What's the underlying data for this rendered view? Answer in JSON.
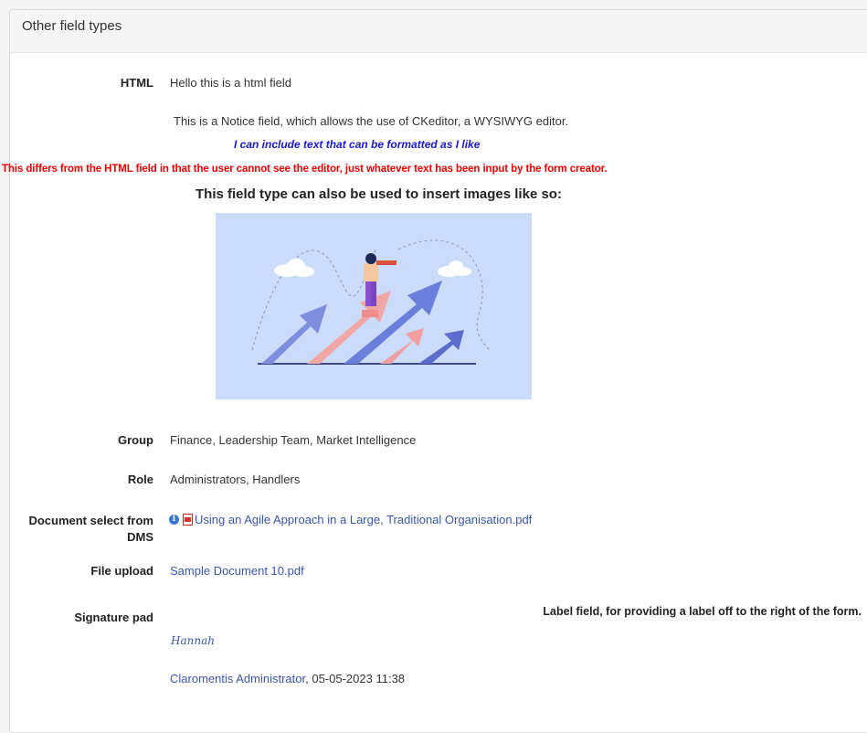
{
  "panel": {
    "title": "Other field types"
  },
  "fields": {
    "html": {
      "label": "HTML",
      "value": "Hello this is a html field"
    },
    "group": {
      "label": "Group",
      "value": "Finance, Leadership Team, Market Intelligence"
    },
    "role": {
      "label": "Role",
      "value": "Administrators, Handlers"
    },
    "dms": {
      "label": "Document select from DMS",
      "value": "Using an Agile Approach in a Large, Traditional Organisation.pdf"
    },
    "upload": {
      "label": "File upload",
      "value": "Sample Document 10.pdf"
    },
    "signature": {
      "label": "Signature pad",
      "signature_text": "Hannah",
      "signer": "Claromentis Administrator",
      "timestamp": ", 05-05-2023 11:38"
    }
  },
  "notice": {
    "line1": "This is a Notice field, which allows the use of CKeditor, a WYSIWYG editor.",
    "line2": "I can include text that can be formatted as I like",
    "line3": "This differs from the HTML field in that the user cannot see the editor, just whatever text has been input by the form creator.",
    "line4": "This field type can also be used to insert images like so:"
  },
  "label_field": {
    "text": "Label field, for providing a label off to the right of the form."
  },
  "icons": {
    "info": "info-icon",
    "pdf": "pdf-file-icon"
  },
  "colors": {
    "link": "#3a55b0",
    "notice_blue": "#1a17d6",
    "notice_red": "#ee0000",
    "illustration_bg": "#cbdcfb"
  }
}
